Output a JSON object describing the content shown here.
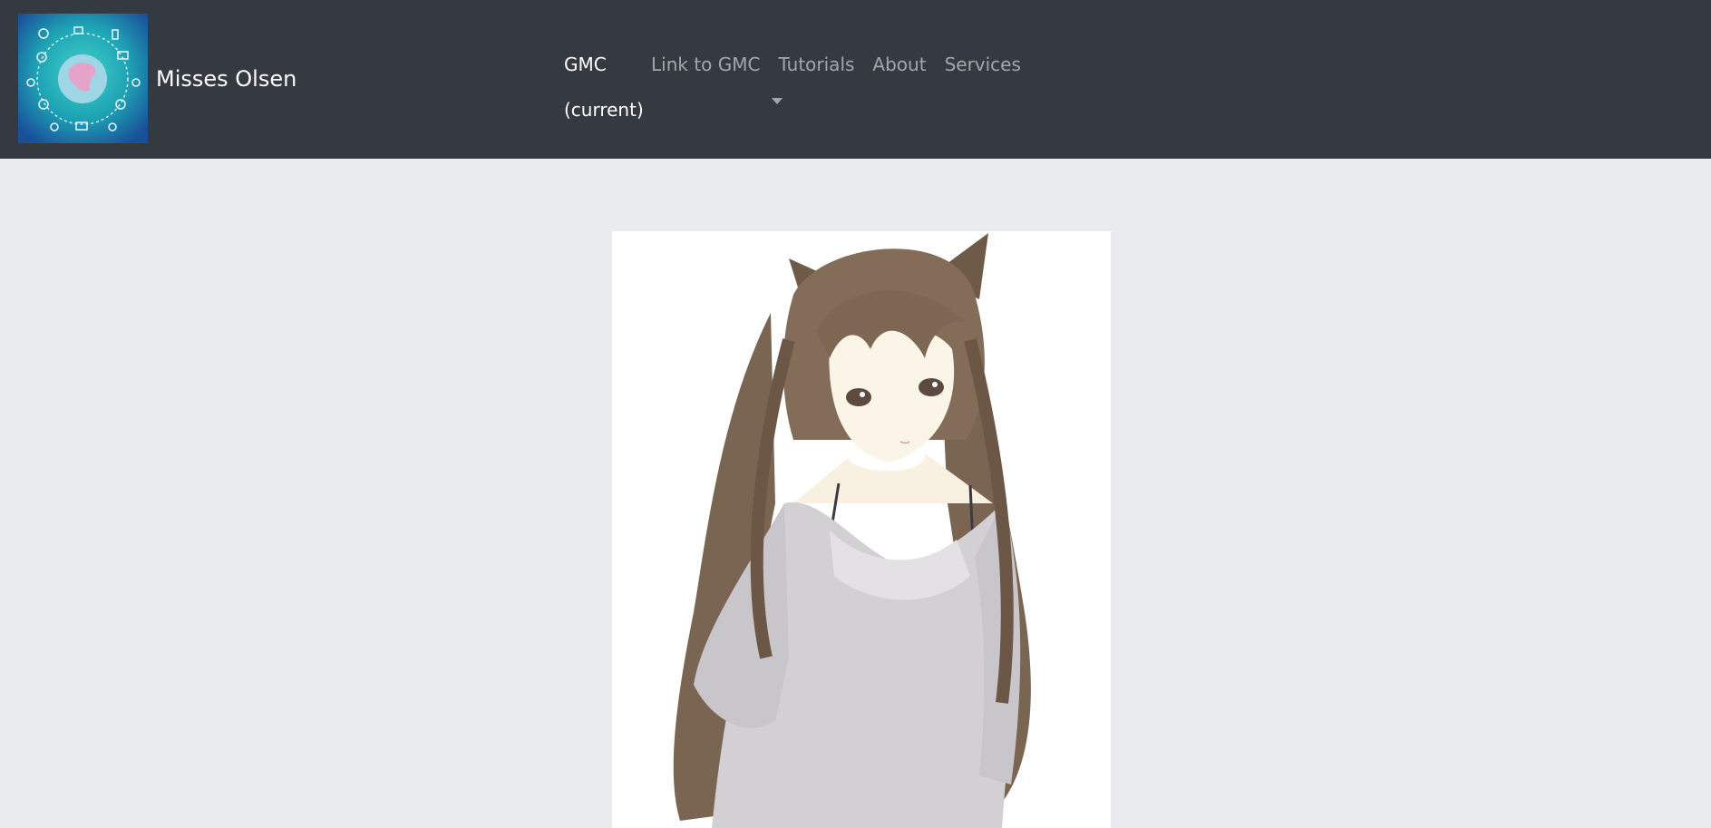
{
  "navbar": {
    "brand": {
      "name": "Misses Olsen",
      "logo_icon": "globe-network-icon"
    },
    "links": [
      {
        "label": "GMC",
        "status": "(current)",
        "active": true
      },
      {
        "label": "Link to GMC",
        "active": false
      },
      {
        "label": "Tutorials",
        "active": false,
        "dropdown": true
      },
      {
        "label": "About",
        "active": false
      },
      {
        "label": "Services",
        "active": false
      }
    ],
    "dropdown_icon": "caret-down-icon"
  },
  "main": {
    "hero_image": "anime-cat-girl-illustration"
  },
  "colors": {
    "navbar_bg": "#343a40",
    "page_bg": "#e9ecef",
    "nav_active": "#ffffff",
    "nav_inactive": "rgba(255,255,255,0.55)"
  }
}
